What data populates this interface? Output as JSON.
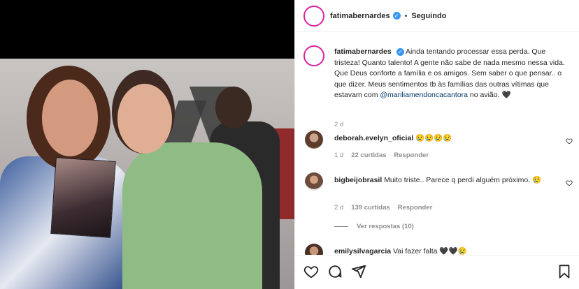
{
  "post": {
    "username": "fatimabernardes",
    "follow_status": "Seguindo",
    "separator": "•",
    "caption": "Ainda tentando processar essa perda. Que tristeza! Quanto talento! A gente não sabe de nada mesmo nessa vida. Que Deus conforte a família e os amigos. Sem saber o que pensar.. o que dizer. Meus sentimentos tb às famílias das outras vítimas que estavam com ",
    "caption_mention": "@mariliamendoncacantora",
    "caption_tail": " no avião. 🖤",
    "time": "2 d"
  },
  "comments": [
    {
      "username": "deborah.evelyn_oficial",
      "text": "😢😢😢😢",
      "time": "1 d",
      "likes": "22 curtidas",
      "reply": "Responder"
    },
    {
      "username": "bigbeijobrasil",
      "text": "Muito triste.. Parece q perdi alguém próximo. 😢",
      "time": "2 d",
      "likes": "139 curtidas",
      "reply": "Responder"
    },
    {
      "username": "emilysilvagarcia",
      "text": "Vai fazer falta 🖤🖤😢"
    }
  ],
  "view_replies": "Ver respostas (10)",
  "icons": {
    "verified": "verified-badge-icon",
    "like": "heart-icon",
    "comment": "comment-icon",
    "share": "share-icon",
    "save": "bookmark-icon"
  },
  "colors": {
    "verified": "#3897f0",
    "mention": "#00376b",
    "secondary_text": "#8e8e8e"
  }
}
